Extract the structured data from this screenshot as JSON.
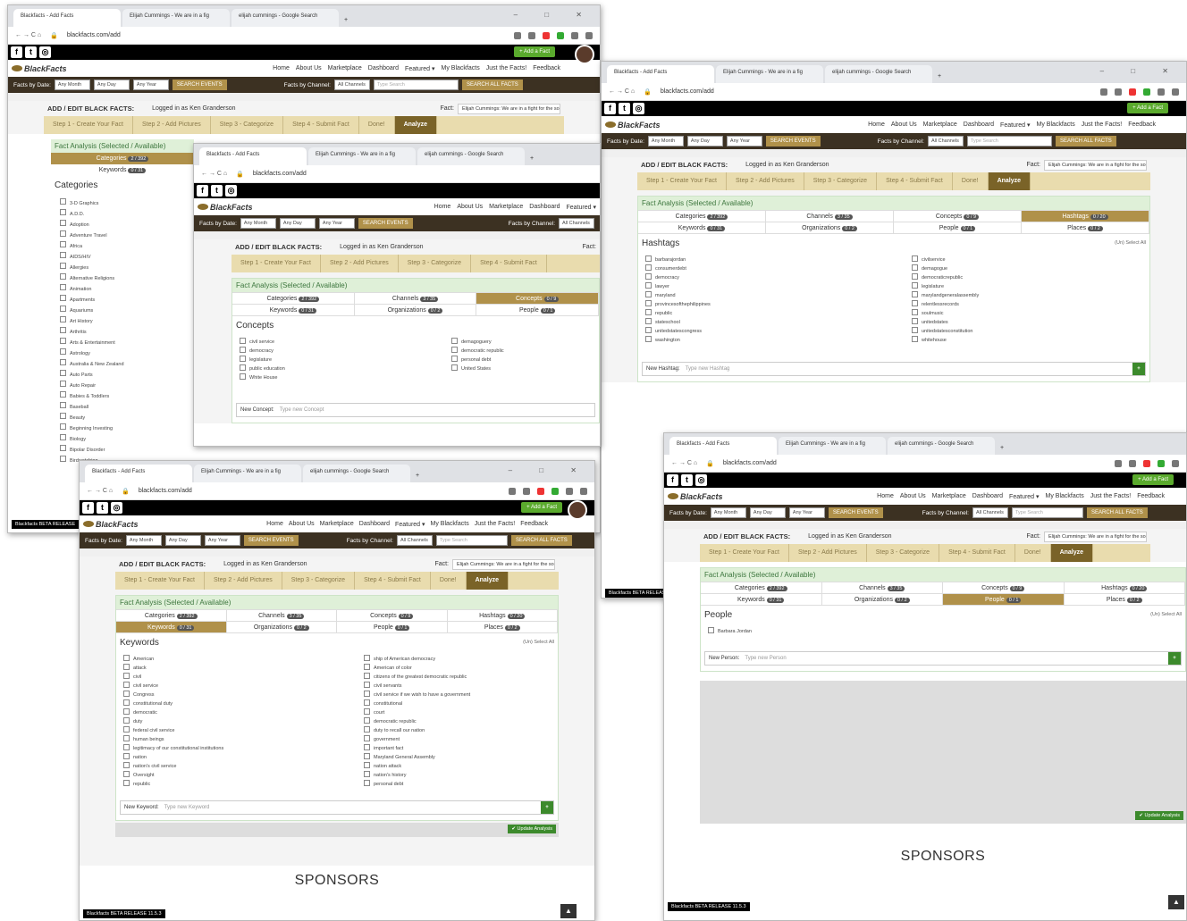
{
  "browser": {
    "tabs": [
      "Blackfacts - Add Facts",
      "Elijah Cummings - We are in a fig",
      "elijah cummings - Google Search"
    ],
    "new_tab": "+",
    "url": "blackfacts.com/add",
    "controls": "– □ ✕"
  },
  "site": {
    "add_fact": "+ Add a Fact",
    "logo": "BlackFacts",
    "nav": [
      "Home",
      "About Us",
      "Marketplace",
      "Dashboard",
      "Featured ▾",
      "My Blackfacts",
      "Just the Facts!",
      "Feedback"
    ],
    "facts_by_date": "Facts by Date:",
    "any_month": "Any Month",
    "any_day": "Any Day",
    "any_year": "Any Year",
    "search_events": "SEARCH EVENTS",
    "facts_by_channel": "Facts by Channel:",
    "all_channels": "All Channels",
    "type_search": "Type Search",
    "search_all": "SEARCH ALL FACTS"
  },
  "form": {
    "title": "ADD / EDIT BLACK FACTS:",
    "logged": "Logged in as Ken Granderson",
    "fact_label": "Fact:",
    "fact_value": "Elijah Cummings: We are in a fight for the soul",
    "steps": [
      "Step 1 - Create Your Fact",
      "Step 2 - Add Pictures",
      "Step 3 - Categorize",
      "Step 4 - Submit Fact",
      "Done!",
      "Analyze"
    ],
    "analysis": "Fact Analysis (Selected / Available)",
    "tabs": [
      {
        "label": "Categories",
        "badge": "2 / 392"
      },
      {
        "label": "Channels",
        "badge": "3 / 35"
      },
      {
        "label": "Concepts",
        "badge": "0 / 9"
      },
      {
        "label": "Hashtags",
        "badge": "0 / 20"
      },
      {
        "label": "Keywords",
        "badge": "0 / 31"
      },
      {
        "label": "Organizations",
        "badge": "0 / 2"
      },
      {
        "label": "People",
        "badge": "0 / 1"
      },
      {
        "label": "Places",
        "badge": "0 / 2"
      }
    ],
    "select_all": "(Un) Select All",
    "update": "✔ Update Analysis"
  },
  "w1": {
    "section": "Categories",
    "items": [
      "3-D Graphics",
      "A.D.D.",
      "Adoption",
      "Adventure Travel",
      "Africa",
      "AIDS/HIV",
      "Allergies",
      "Alternative Religions",
      "Animation",
      "Apartments",
      "Aquariums",
      "Art History",
      "Arthritis",
      "Arts & Entertainment",
      "Astrology",
      "Australia & New Zealand",
      "Auto Parts",
      "Auto Repair",
      "Babies & Toddlers",
      "Baseball",
      "Beauty",
      "Beginning Investing",
      "Biology",
      "Bipolar Disorder",
      "Birdwatching"
    ],
    "beta": "Blackfacts BETA RELEASE"
  },
  "w2": {
    "section": "Concepts",
    "items": [
      "civil service",
      "democracy",
      "legislature",
      "public education",
      "White House",
      "demagoguery",
      "democratic republic",
      "personal debt",
      "United States"
    ],
    "new_label": "New Concept:",
    "new_ph": "Type new Concept"
  },
  "w3": {
    "section": "Hashtags",
    "items": [
      "barbarajordan",
      "consumerdebt",
      "democracy",
      "lawyer",
      "maryland",
      "provincesofthephilippines",
      "republic",
      "stateschool",
      "unitedstatescongress",
      "washington",
      "civilservice",
      "demagogue",
      "democraticrepublic",
      "legislature",
      "marylandgeneralassembly",
      "relentlessrecords",
      "soulmusic",
      "unitedstates",
      "unitedstatesconstitution",
      "whitehouse"
    ],
    "new_label": "New Hashtag:",
    "new_ph": "Type new Hashtag",
    "beta": "Blackfacts BETA RELEASE"
  },
  "w4": {
    "section": "Keywords",
    "items": [
      "American",
      "attack",
      "civil",
      "civil service",
      "Congress",
      "constitutional duty",
      "democratic",
      "duty",
      "federal civil service",
      "human beings",
      "legitimacy of our constitutional institutions",
      "nation",
      "nation's civil service",
      "Oversight",
      "republic",
      "ship of American democracy",
      "American of color",
      "citizens of the greatest democratic republic",
      "civil servants",
      "civil service if we wish to have a government",
      "constitutional",
      "court",
      "democratic republic",
      "duty to recall our nation",
      "government",
      "important fact",
      "Maryland General Assembly",
      "nation attack",
      "nation's history",
      "personal debt",
      "service"
    ],
    "new_label": "New Keyword:",
    "new_ph": "Type new Keyword",
    "sponsors": "SPONSORS",
    "beta": "Blackfacts BETA RELEASE 11.5.3"
  },
  "w5": {
    "section": "People",
    "items": [
      "Barbara Jordan"
    ],
    "new_label": "New Person:",
    "new_ph": "Type new Person",
    "sponsors": "SPONSORS",
    "beta": "Blackfacts BETA RELEASE 11.5.3"
  }
}
